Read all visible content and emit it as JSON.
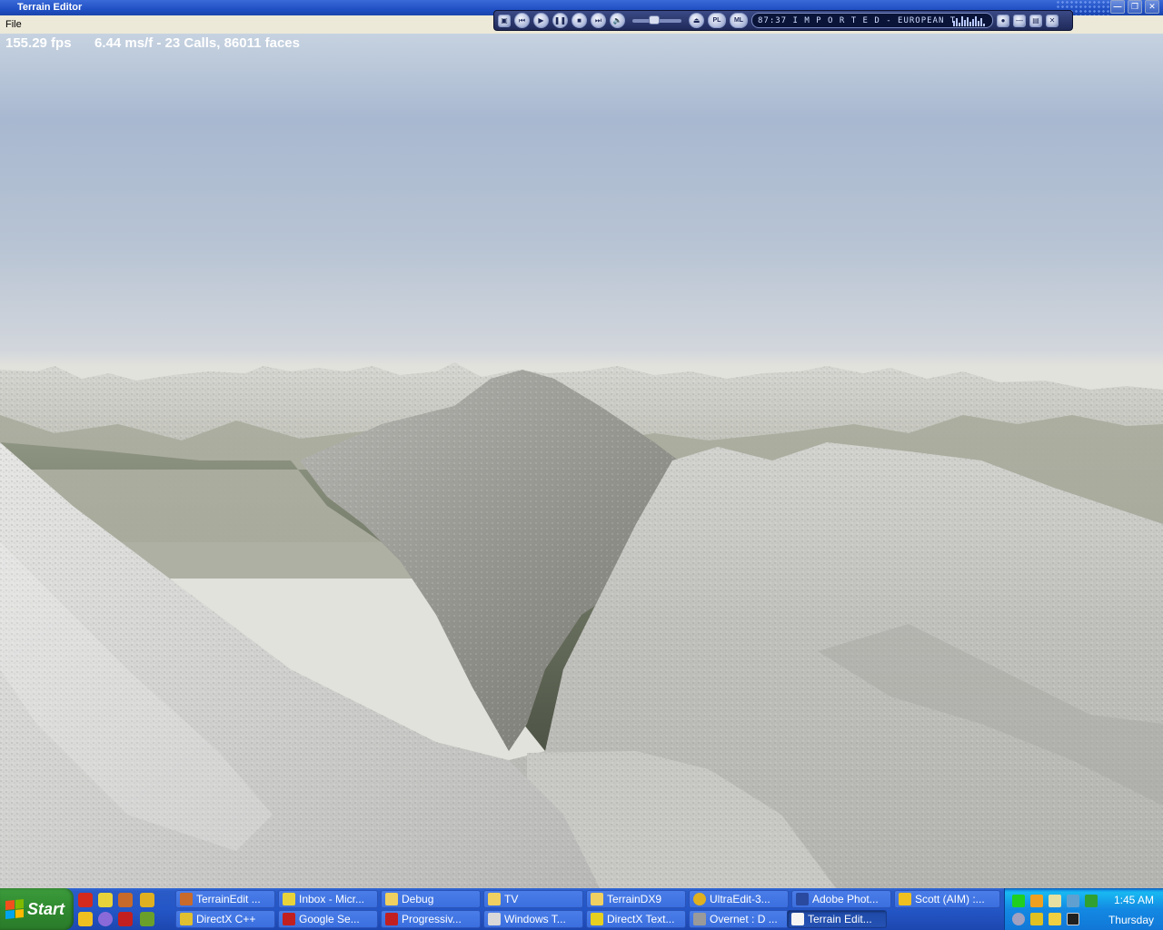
{
  "window": {
    "title": "Terrain Editor"
  },
  "menubar": {
    "items": [
      "File"
    ]
  },
  "viewport": {
    "fps_text": "155.29 fps",
    "stats_text": "6.44 ms/f - 23 Calls, 86011 faces"
  },
  "player": {
    "track_text": "87:37  I M P O R T E D - EUROPEAN T",
    "pl_label": "PL",
    "ml_label": "ML"
  },
  "taskbar": {
    "start_label": "Start",
    "tasks_row1": [
      "TerrainEdit ...",
      "Inbox - Micr...",
      "Debug",
      "TV",
      "TerrainDX9",
      "UltraEdit-3...",
      "Adobe Phot...",
      "Scott (AIM) :..."
    ],
    "tasks_row2": [
      "DirectX C++",
      "Google Se...",
      "Progressiv...",
      "Windows T...",
      "DirectX Text...",
      "Overnet : D ...",
      "Terrain Edit..."
    ],
    "clock_time": "1:45 AM",
    "clock_day": "Thursday"
  },
  "colors": {
    "titlebar": "#2456c7",
    "taskbar": "#245edb",
    "start_green": "#2f8a2f",
    "sky_top": "#a8b8d0",
    "snow": "#dcdcd8"
  }
}
